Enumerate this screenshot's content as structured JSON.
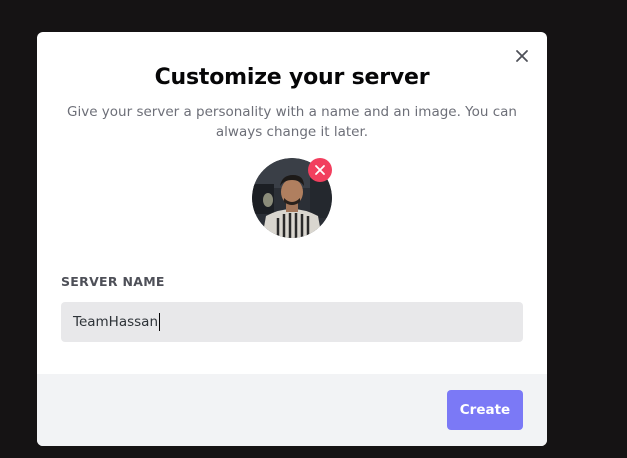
{
  "modal": {
    "title": "Customize your server",
    "subtitle": "Give your server a personality with a name and an image. You can always change it later.",
    "close_icon": "close-icon",
    "avatar": {
      "icon": "server-image-avatar",
      "remove_icon": "remove-image-icon"
    },
    "server_name": {
      "label": "SERVER NAME",
      "value": "TeamHassan"
    },
    "create_label": "Create"
  },
  "colors": {
    "backdrop": "#151314",
    "modal_bg": "#ffffff",
    "footer_bg": "#f2f3f5",
    "accent": "#7b79f6",
    "danger": "#f23f5e",
    "input_bg": "#e8e8ea"
  }
}
